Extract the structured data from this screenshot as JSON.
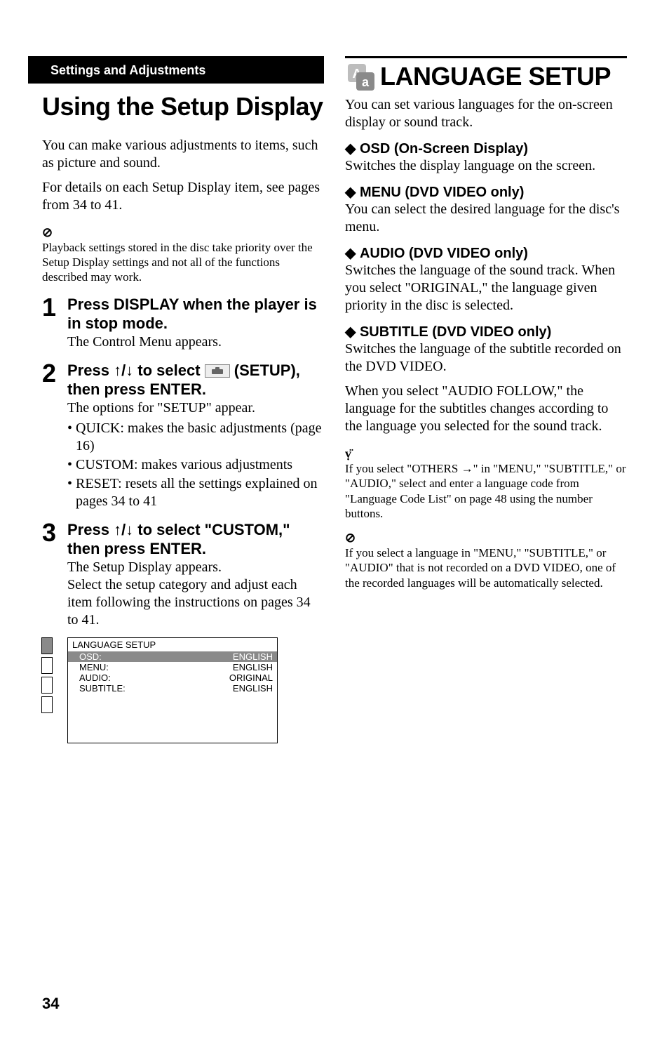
{
  "left": {
    "section_label": "Settings and Adjustments",
    "title": "Using the Setup Display",
    "intro_1": "You can make various adjustments to items, such as picture and sound.",
    "intro_2": "For details on each Setup Display item, see pages from 34 to 41.",
    "note_icon": "⊘",
    "note_text": "Playback settings stored in the disc take priority over the Setup Display settings and not all of the functions described may work.",
    "steps": [
      {
        "num": "1",
        "head": "Press DISPLAY when the player is in stop mode.",
        "para": "The Control Menu appears."
      },
      {
        "num": "2",
        "head_before": "Press ",
        "head_arrows": "↑/↓",
        "head_mid": " to select ",
        "head_after": " (SETUP), then press ENTER.",
        "para": "The options for \"SETUP\" appear.",
        "bullets": [
          "QUICK: makes the basic adjustments (page 16)",
          "CUSTOM: makes various adjustments",
          "RESET: resets all the settings explained on pages 34 to 41"
        ]
      },
      {
        "num": "3",
        "head_before": "Press ",
        "head_arrows": "↑/↓",
        "head_after": " to select \"CUSTOM,\" then press ENTER.",
        "para": "The Setup Display appears.",
        "para2": "Select the setup category and adjust each item following the instructions on pages 34 to 41."
      }
    ],
    "setup_table": {
      "title": "LANGUAGE SETUP",
      "rows": [
        {
          "label": "OSD:",
          "value": "ENGLISH",
          "selected": true
        },
        {
          "label": "MENU:",
          "value": "ENGLISH",
          "selected": false
        },
        {
          "label": "AUDIO:",
          "value": "ORIGINAL",
          "selected": false
        },
        {
          "label": "SUBTITLE:",
          "value": "ENGLISH",
          "selected": false
        }
      ]
    }
  },
  "right": {
    "title": "LANGUAGE SETUP",
    "intro": "You can set various languages for the on-screen display or sound track.",
    "sections": [
      {
        "head": "OSD (On-Screen Display)",
        "body": [
          "Switches the display language on the screen."
        ]
      },
      {
        "head": "MENU (DVD VIDEO only)",
        "body": [
          "You can select the desired language for the disc's menu."
        ]
      },
      {
        "head": "AUDIO (DVD VIDEO only)",
        "body": [
          "Switches the language of the sound track. When you select \"ORIGINAL,\" the language given priority in the disc is selected."
        ]
      },
      {
        "head": "SUBTITLE (DVD VIDEO only)",
        "body": [
          "Switches the language of the subtitle recorded on the DVD VIDEO.",
          "When you select \"AUDIO FOLLOW,\" the language for the subtitles changes according to the language you selected for the sound track."
        ]
      }
    ],
    "tip_icon": "ṿ̈",
    "tip_text": "If you select \"OTHERS →\" in \"MENU,\" \"SUBTITLE,\" or \"AUDIO,\" select and enter a language code from \"Language Code List\" on page 48 using the number buttons.",
    "note_icon": "⊘",
    "note_text": "If you select a language in \"MENU,\" \"SUBTITLE,\" or \"AUDIO\" that is not recorded on a DVD VIDEO, one of the recorded languages will be automatically selected."
  },
  "page_number": "34"
}
